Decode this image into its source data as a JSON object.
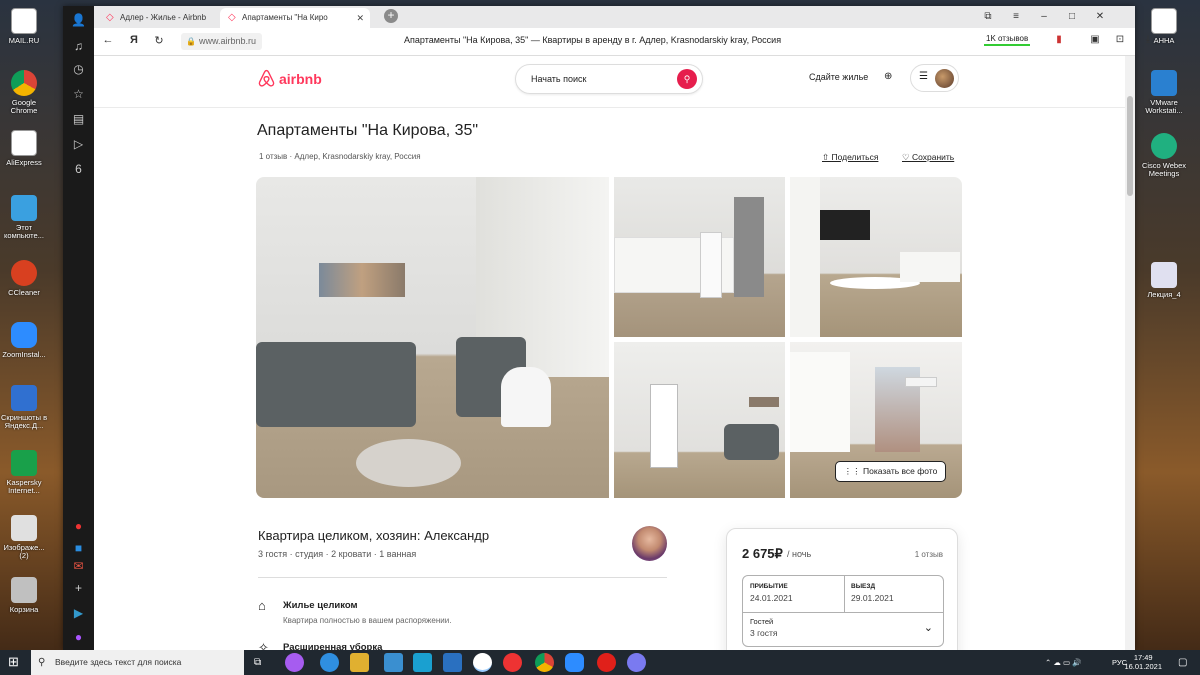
{
  "desktop": {
    "left_icons": [
      {
        "label": "MAIL.RU",
        "color": "#ffffff"
      },
      {
        "label": "Google Chrome",
        "color": "#e0e0e0"
      },
      {
        "label": "AliExpress",
        "color": "#ffffff"
      },
      {
        "label": "Этот компьюте...",
        "color": "#3aa0e0"
      },
      {
        "label": "CCleaner",
        "color": "#d84020"
      },
      {
        "label": "ZoomInstal...",
        "color": "#2d8cff"
      },
      {
        "label": "Скриншоты в Яндекс.Д...",
        "color": "#3070d0"
      },
      {
        "label": "Kaspersky Internet...",
        "color": "#19a04a"
      },
      {
        "label": "Изображе... (2)",
        "color": "#e0e0e0"
      },
      {
        "label": "Корзина",
        "color": "#c0c0c0"
      }
    ],
    "right_icons": [
      {
        "label": "АННА",
        "color": "#ffffff"
      },
      {
        "label": "VMware Workstati...",
        "color": "#2a80d0"
      },
      {
        "label": "Cisco Webex Meetings",
        "color": "#20b080"
      },
      {
        "label": "Лекция_4",
        "color": "#e0e0f0"
      }
    ]
  },
  "browser": {
    "tabs": [
      {
        "label": "Адлер - Жилье - Airbnb"
      },
      {
        "label": "Апартаменты \"На Киро"
      }
    ],
    "url": "www.airbnb.ru",
    "page_title": "Апартаменты \"На Кирова, 35\" — Квартиры в аренду в г. Адлер, Krasnodarskiy kray, Россия",
    "reviews_pill": "1K отзывов"
  },
  "airbnb": {
    "logo": "airbnb",
    "search_placeholder": "Начать поиск",
    "host_link": "Сдайте жилье",
    "title": "Апартаменты \"На Кирова, 35\"",
    "reviews": "1 отзыв",
    "location": "Адлер, Krasnodarskiy kray, Россия",
    "share": "Поделиться",
    "save": "Сохранить",
    "show_all_photos": "Показать все фото",
    "listing_heading": "Квартира целиком, хозяин: Александр",
    "listing_details": "3 гостя · студия · 2 кровати · 1 ванная",
    "features": [
      {
        "title": "Жилье целиком",
        "desc": "Квартира полностью в вашем распоряжении."
      },
      {
        "title": "Расширенная уборка",
        "desc": ""
      }
    ],
    "booking": {
      "price": "2 675₽",
      "per": "/ ночь",
      "reviews": "1 отзыв",
      "checkin_label": "Прибытие",
      "checkin_value": "24.01.2021",
      "checkout_label": "Выезд",
      "checkout_value": "29.01.2021",
      "guests_label": "Гостей",
      "guests_value": "3 гостя"
    },
    "accent": "#ff385c"
  },
  "taskbar": {
    "search_placeholder": "Введите здесь текст для поиска",
    "lang": "РУС",
    "time": "17:49",
    "date": "16.01.2021"
  }
}
